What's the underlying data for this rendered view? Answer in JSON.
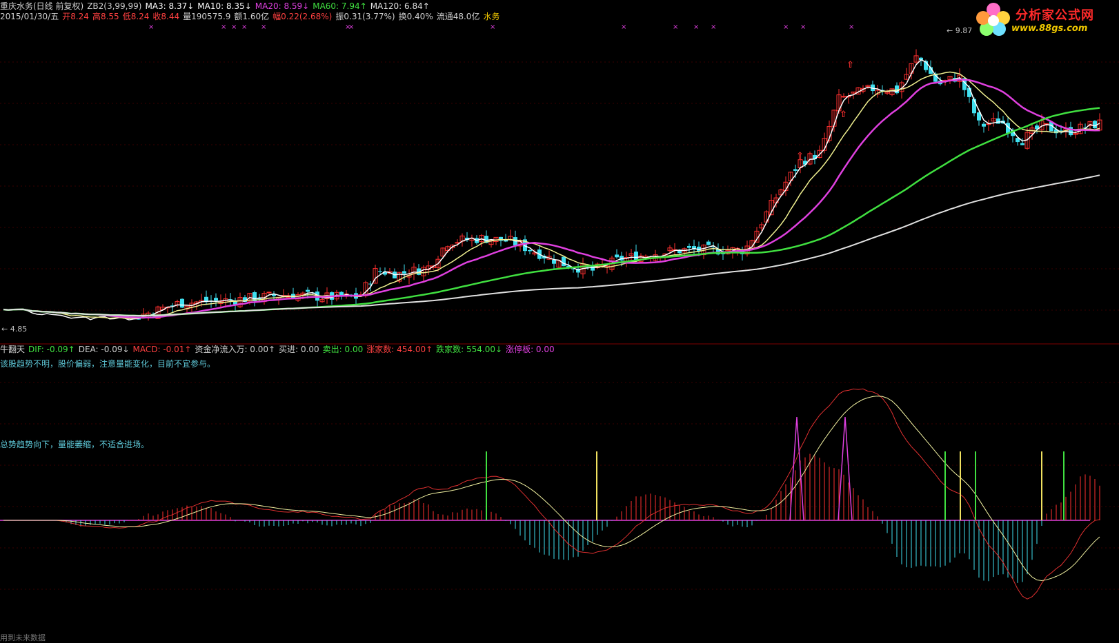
{
  "header": {
    "line1": [
      {
        "text": "重庆水务(日线 前复权)",
        "color": "#d0d0d0"
      },
      {
        "text": "ZB2(3,99,99)",
        "color": "#d0d0d0"
      },
      {
        "text": "MA3: 8.37↓",
        "color": "#ffffff"
      },
      {
        "text": "MA10: 8.35↓",
        "color": "#ffffff"
      },
      {
        "text": "MA20: 8.59↓",
        "color": "#e040e0"
      },
      {
        "text": "MA60: 7.94↑",
        "color": "#40e040"
      },
      {
        "text": "MA120: 6.84↑",
        "color": "#e0e0e0"
      }
    ],
    "line2": [
      {
        "text": "2015/01/30/五",
        "color": "#d0d0d0"
      },
      {
        "text": "开8.24",
        "color": "#ff4040"
      },
      {
        "text": "高8.55",
        "color": "#ff4040"
      },
      {
        "text": "低8.24",
        "color": "#ff4040"
      },
      {
        "text": "收8.44",
        "color": "#ff4040"
      },
      {
        "text": "量190575.9",
        "color": "#d0d0d0"
      },
      {
        "text": "额1.60亿",
        "color": "#d0d0d0"
      },
      {
        "text": "幅0.22(2.68%)",
        "color": "#ff4040"
      },
      {
        "text": "振0.31(3.77%)",
        "color": "#d0d0d0"
      },
      {
        "text": "换0.40%",
        "color": "#d0d0d0"
      },
      {
        "text": "流通48.0亿",
        "color": "#d0d0d0"
      },
      {
        "text": "水务",
        "color": "#f0c800"
      }
    ]
  },
  "indicator_header": [
    {
      "text": "牛翻天",
      "color": "#d0d0d0"
    },
    {
      "text": "DIF: -0.09↑",
      "color": "#40e040"
    },
    {
      "text": "DEA: -0.09↓",
      "color": "#d0d0d0"
    },
    {
      "text": "MACD: -0.01↑",
      "color": "#ff4040"
    },
    {
      "text": "资金净流入万: 0.00↑",
      "color": "#d0d0d0"
    },
    {
      "text": "买进: 0.00",
      "color": "#d0d0d0"
    },
    {
      "text": "卖出: 0.00",
      "color": "#40e040"
    },
    {
      "text": "涨家数: 454.00↑",
      "color": "#ff4040"
    },
    {
      "text": "跌家数: 554.00↓",
      "color": "#40e040"
    },
    {
      "text": "涨停板: 0.00",
      "color": "#e040e0"
    }
  ],
  "notes": {
    "note1": "该股趋势不明，股价偏弱，注意量能变化，目前不宜参与。",
    "note2": "总势趋势向下，量能萎缩，不适合进场。"
  },
  "price_labels": {
    "high": "9.87",
    "low": "4.85"
  },
  "logo": {
    "name": "分析家公式网",
    "url": "www.88gs.com"
  },
  "footer": "用到未来数据",
  "colors": {
    "up": "#ff3030",
    "down": "#40e0f0",
    "ma3": "#ffffff",
    "ma10": "#f0f090",
    "ma20": "#e040e0",
    "ma60": "#40e040",
    "ma120": "#e0e0e0"
  }
}
